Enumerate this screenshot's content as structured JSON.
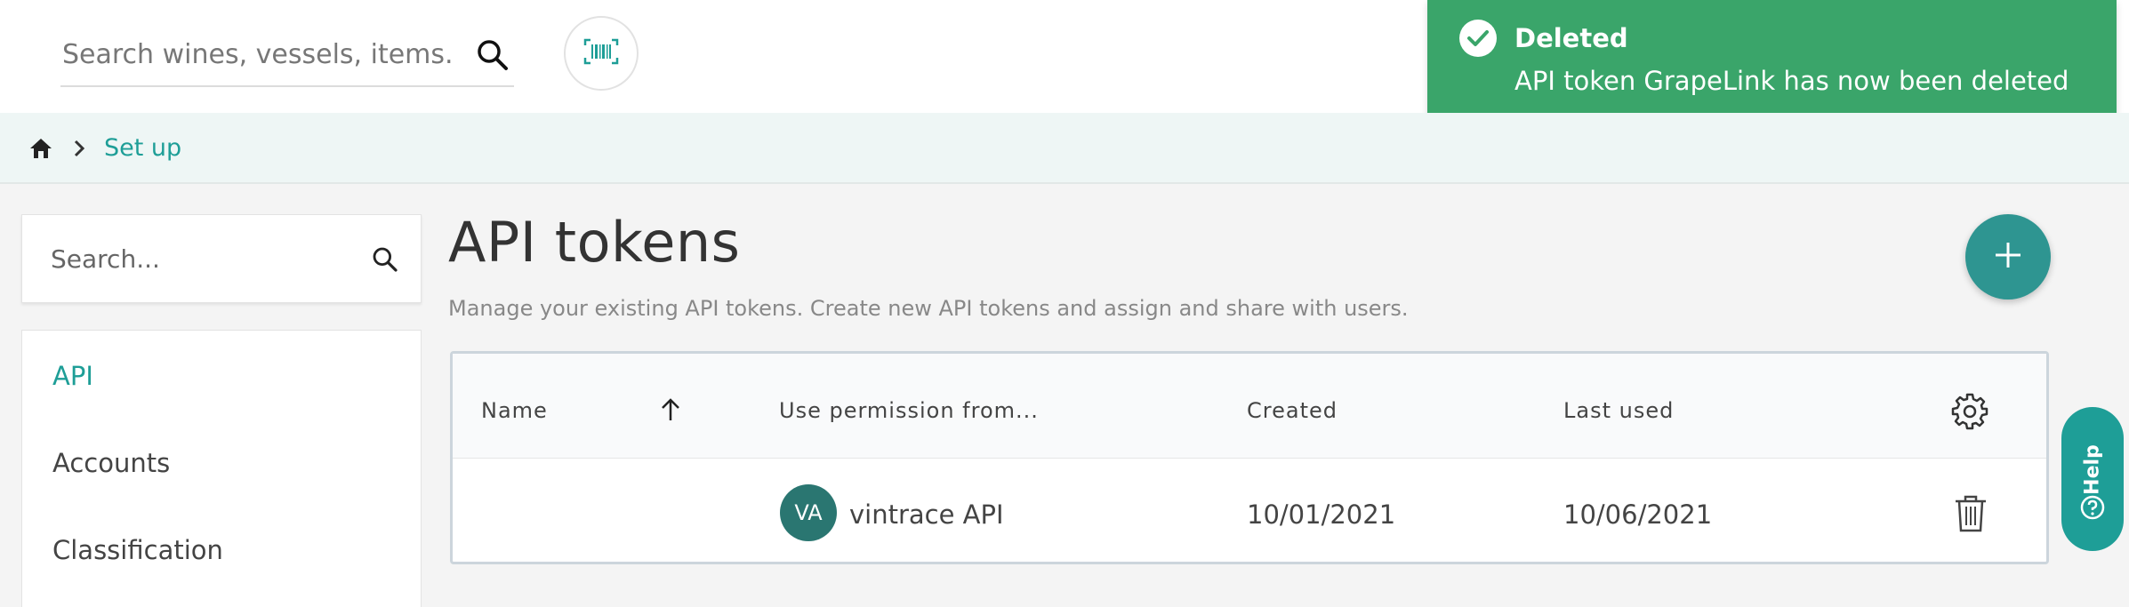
{
  "header": {
    "search_placeholder": "Search wines, vessels, items...",
    "icons": {
      "search": "search-icon",
      "barcode": "barcode-scan-icon"
    }
  },
  "toast": {
    "title": "Deleted",
    "message": "API token GrapeLink has now been deleted",
    "color": "#3aa56a",
    "icon": "check-circle-icon"
  },
  "breadcrumb": {
    "home_icon": "home-icon",
    "separator_icon": "chevron-right-icon",
    "items": [
      "Set up"
    ]
  },
  "sidebar": {
    "search_placeholder": "Search...",
    "items": [
      {
        "label": "API",
        "active": true
      },
      {
        "label": "Accounts",
        "active": false
      },
      {
        "label": "Classification",
        "active": false
      }
    ]
  },
  "main": {
    "title": "API tokens",
    "description": "Manage your existing API tokens. Create new API tokens and assign and share with users.",
    "add_button_icon": "plus-icon"
  },
  "table": {
    "columns": [
      "Name",
      "Use permission from...",
      "Created",
      "Last used"
    ],
    "sort_icon": "arrow-up-icon",
    "settings_icon": "gear-icon",
    "rows": [
      {
        "name": "",
        "avatar_initials": "VA",
        "permission_from": "vintrace API",
        "created": "10/01/2021",
        "last_used": "10/06/2021",
        "action_icon": "trash-icon"
      }
    ]
  },
  "help": {
    "label": "Help",
    "icon": "question-circle-icon"
  },
  "colors": {
    "accent": "#1e9e97",
    "avatar": "#2a7671",
    "add_button": "#2e9591",
    "success": "#3aa56a"
  }
}
